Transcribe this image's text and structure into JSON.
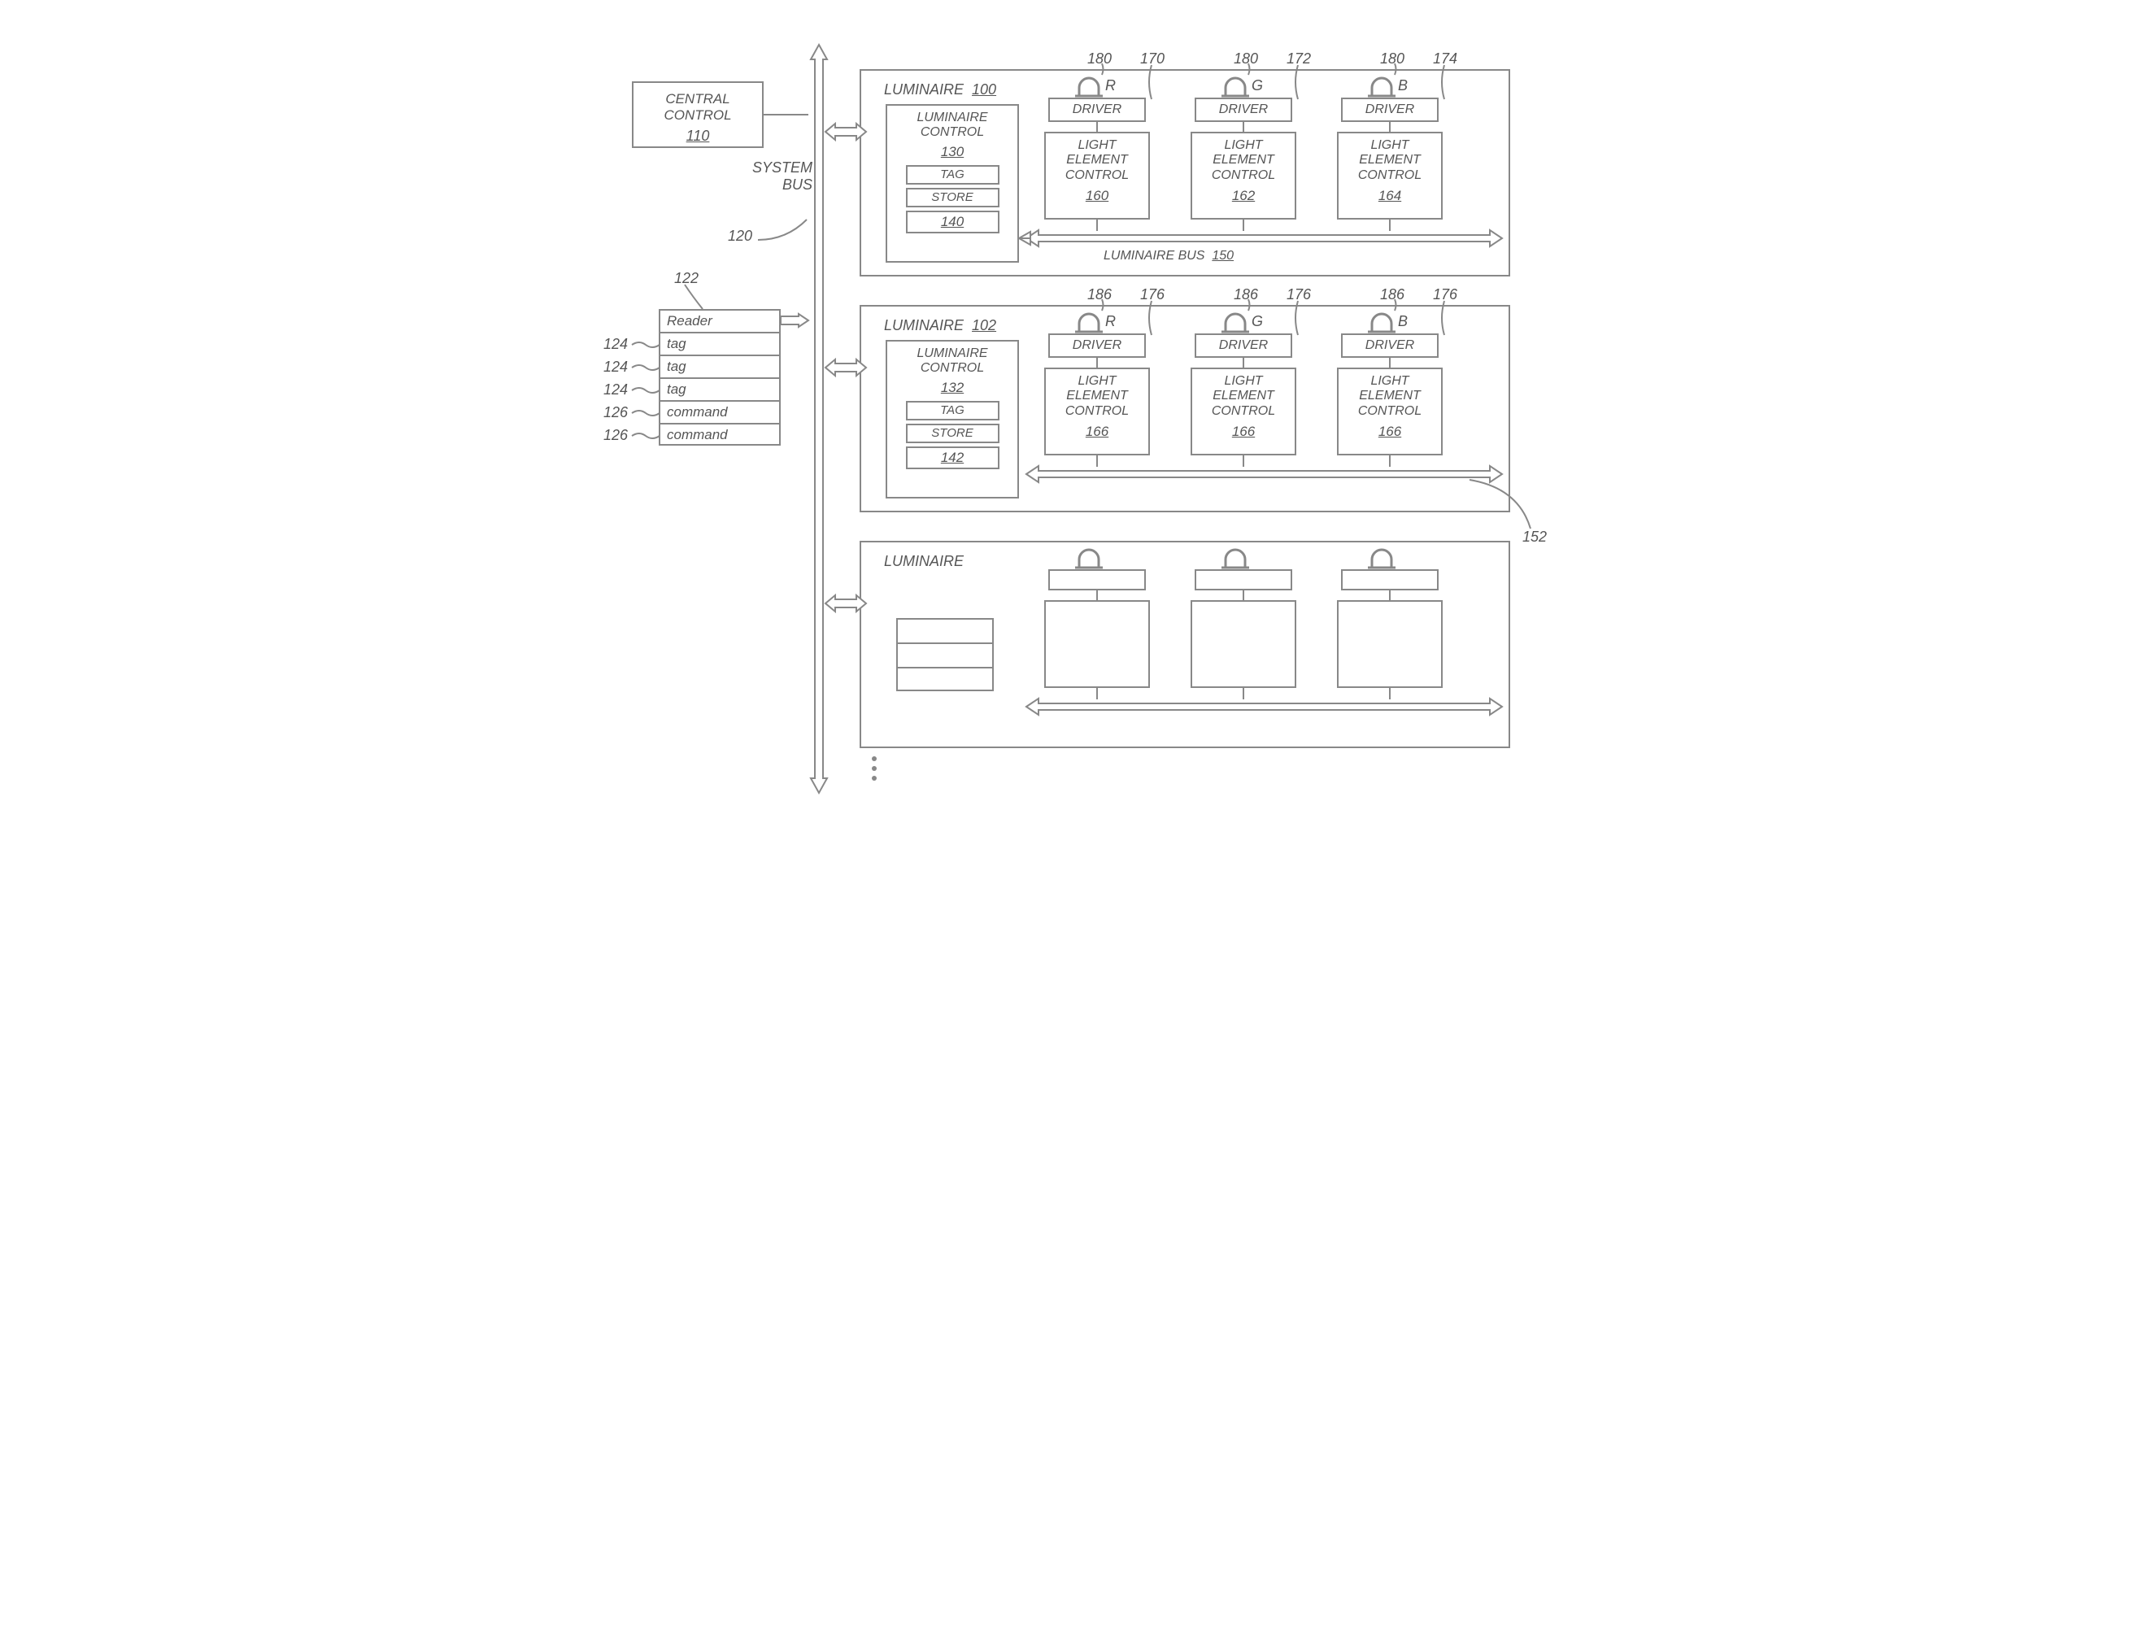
{
  "central_control": {
    "title": "CENTRAL CONTROL",
    "ref": "110"
  },
  "system_bus": {
    "label": "SYSTEM BUS",
    "ref": "120"
  },
  "reader": {
    "ref": "122",
    "rows": [
      "Reader",
      "tag",
      "tag",
      "tag",
      "command",
      "command"
    ],
    "row_refs": [
      "",
      "124",
      "124",
      "124",
      "126",
      "126"
    ]
  },
  "luminaires": [
    {
      "title": "LUMINAIRE",
      "ref": "100",
      "control": {
        "title": "LUMINAIRE CONTROL",
        "ref": "130",
        "tag": "TAG",
        "store": "STORE",
        "store_ref": "140"
      },
      "bus_label": "LUMINAIRE BUS",
      "bus_ref": "150",
      "elements": [
        {
          "led_ref": "180",
          "led_color": "R",
          "driver_ref": "170",
          "driver": "DRIVER",
          "lec": "LIGHT ELEMENT CONTROL",
          "lec_ref": "160"
        },
        {
          "led_ref": "180",
          "led_color": "G",
          "driver_ref": "172",
          "driver": "DRIVER",
          "lec": "LIGHT ELEMENT CONTROL",
          "lec_ref": "162"
        },
        {
          "led_ref": "180",
          "led_color": "B",
          "driver_ref": "174",
          "driver": "DRIVER",
          "lec": "LIGHT ELEMENT CONTROL",
          "lec_ref": "164"
        }
      ]
    },
    {
      "title": "LUMINAIRE",
      "ref": "102",
      "control": {
        "title": "LUMINAIRE CONTROL",
        "ref": "132",
        "tag": "TAG",
        "store": "STORE",
        "store_ref": "142"
      },
      "bus_label": "",
      "bus_ref": "152",
      "elements": [
        {
          "led_ref": "186",
          "led_color": "R",
          "driver_ref": "176",
          "driver": "DRIVER",
          "lec": "LIGHT ELEMENT CONTROL",
          "lec_ref": "166"
        },
        {
          "led_ref": "186",
          "led_color": "G",
          "driver_ref": "176",
          "driver": "DRIVER",
          "lec": "LIGHT ELEMENT CONTROL",
          "lec_ref": "166"
        },
        {
          "led_ref": "186",
          "led_color": "B",
          "driver_ref": "176",
          "driver": "DRIVER",
          "lec": "LIGHT ELEMENT CONTROL",
          "lec_ref": "166"
        }
      ]
    },
    {
      "title": "LUMINAIRE",
      "ref": "",
      "control": null,
      "bus_label": "",
      "bus_ref": ""
    }
  ]
}
